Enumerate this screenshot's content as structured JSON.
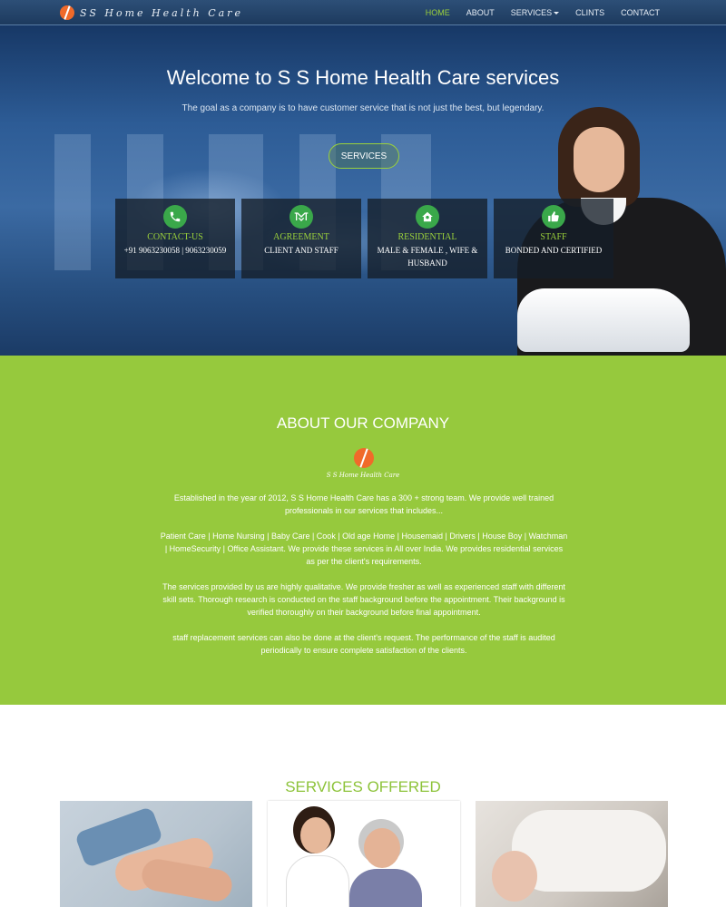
{
  "nav": {
    "brand": "SS Home Health Care",
    "links": [
      {
        "label": "HOME",
        "active": true
      },
      {
        "label": "ABOUT"
      },
      {
        "label": "SERVICES",
        "has_dropdown": true
      },
      {
        "label": "CLINTS"
      },
      {
        "label": "CONTACT"
      }
    ]
  },
  "hero": {
    "title": "Welcome to S S Home Health Care services",
    "subtitle": "The goal as a company is to have customer service that is not just the best, but legendary.",
    "button": "SERVICES"
  },
  "cards": [
    {
      "icon": "phone-icon",
      "title": "CONTACT-US",
      "text": "+91 9063230058 | 9063230059"
    },
    {
      "icon": "handshake-icon",
      "title": "AGREEMENT",
      "text": "CLIENT AND STAFF"
    },
    {
      "icon": "home-icon",
      "title": "RESIDENTIAL",
      "text": "MALE & FEMALE , WIFE & HUSBAND"
    },
    {
      "icon": "thumbs-up-icon",
      "title": "STAFF",
      "text": "BONDED AND CERTIFIED"
    }
  ],
  "about": {
    "title": "ABOUT OUR COMPANY",
    "logo_text": "S S Home Health Care",
    "paragraphs": [
      "Established in the year of 2012, S S Home Health Care has a 300 + strong team. We provide well trained professionals in our services that includes...",
      "Patient Care | Home Nursing | Baby Care | Cook | Old age Home | Housemaid | Drivers | House Boy | Watchman | HomeSecurity | Office Assistant. We provide these services in All over India. We provides residential services as per the client's requirements.",
      "The services provided by us are highly qualitative. We provide fresher as well as experienced staff with different skill sets. Thorough research is conducted on the staff background before the appointment. Their background is verified thoroughly on their background before final appointment.",
      "staff replacement services can also be done at the client's request. The performance of the staff is audited periodically to ensure complete satisfaction of the clients."
    ]
  },
  "services": {
    "title": "SERVICES OFFERED"
  },
  "colors": {
    "accent_green": "#96c93d",
    "nav_bg": "#1d3a5e",
    "icon_green": "#3aa84a",
    "logo_orange": "#f06a2a"
  }
}
